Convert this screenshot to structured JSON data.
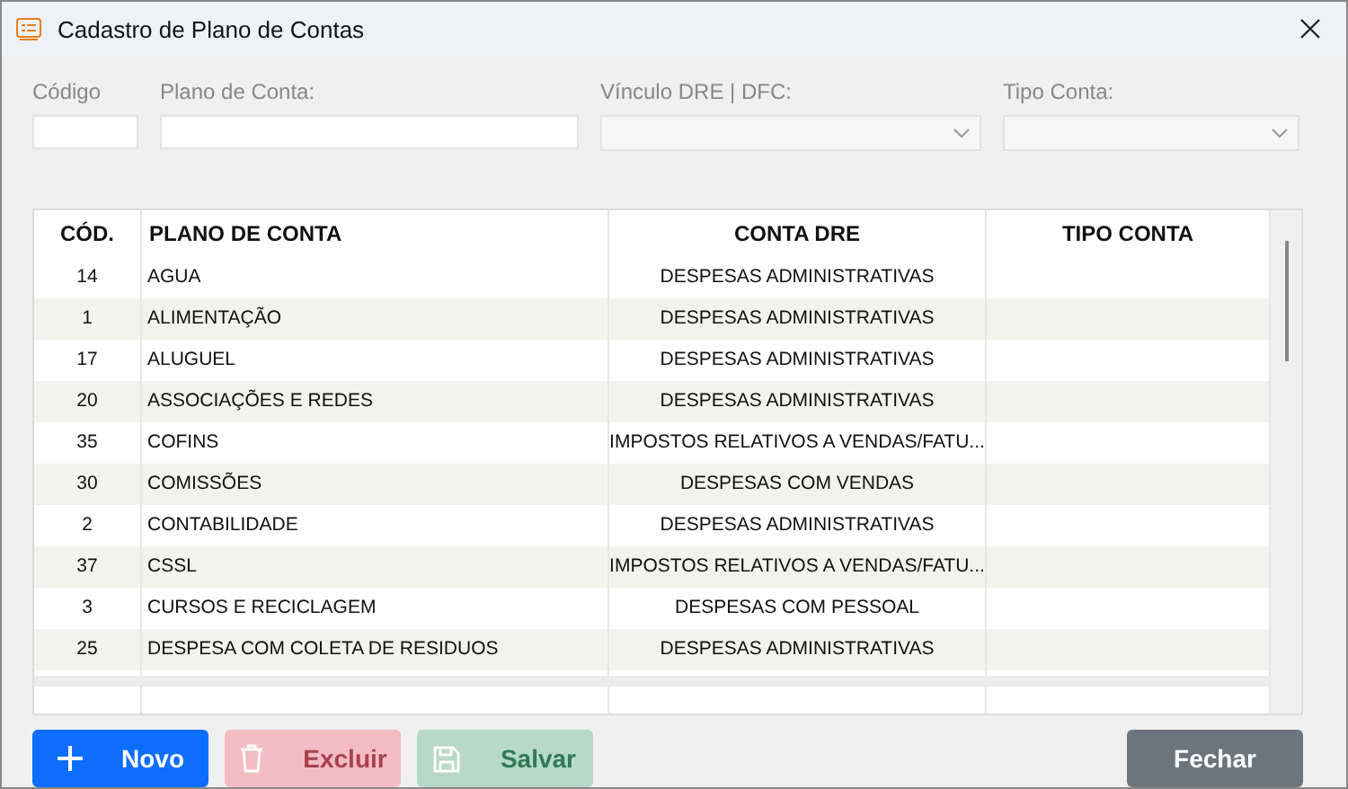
{
  "window": {
    "title": "Cadastro de Plano de Contas"
  },
  "filters": [
    {
      "kind": "text",
      "label": "Código"
    },
    {
      "kind": "text",
      "label": "Plano de Conta:"
    },
    {
      "kind": "select",
      "label": "Vínculo DRE | DFC:"
    },
    {
      "kind": "select",
      "label": "Tipo Conta:"
    }
  ],
  "table": {
    "columns": [
      "CÓD.",
      "PLANO DE CONTA",
      "CONTA DRE",
      "TIPO CONTA"
    ],
    "rows": [
      [
        "14",
        "AGUA",
        "DESPESAS ADMINISTRATIVAS"
      ],
      [
        "1",
        "ALIMENTAÇÃO",
        "DESPESAS ADMINISTRATIVAS"
      ],
      [
        "17",
        "ALUGUEL",
        "DESPESAS ADMINISTRATIVAS"
      ],
      [
        "20",
        "ASSOCIAÇÕES E REDES",
        "DESPESAS ADMINISTRATIVAS"
      ],
      [
        "35",
        "COFINS",
        "IMPOSTOS RELATIVOS A VENDAS/FATU..."
      ],
      [
        "30",
        "COMISSÕES",
        "DESPESAS COM VENDAS"
      ],
      [
        "2",
        "CONTABILIDADE",
        "DESPESAS ADMINISTRATIVAS"
      ],
      [
        "37",
        "CSSL",
        "IMPOSTOS RELATIVOS A VENDAS/FATU..."
      ],
      [
        "3",
        "CURSOS E RECICLAGEM",
        "DESPESAS COM PESSOAL"
      ],
      [
        "25",
        "DESPESA COM COLETA DE RESIDUOS",
        "DESPESAS ADMINISTRATIVAS"
      ]
    ]
  },
  "buttons": [
    {
      "kind": "new",
      "label": "Novo",
      "disabled": false
    },
    {
      "kind": "delete",
      "label": "Excluir",
      "disabled": true
    },
    {
      "kind": "save",
      "label": "Salvar",
      "disabled": true
    },
    {
      "kind": "close",
      "label": "Fechar",
      "disabled": false
    }
  ]
}
